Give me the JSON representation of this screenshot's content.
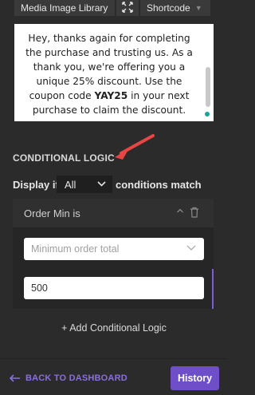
{
  "toolbar": {
    "media_label": "Media Image Library",
    "expand_icon": "expand-icon",
    "shortcode_label": "Shortcode"
  },
  "editor": {
    "text_before": "Hey, thanks again for completing the purchase and trusting us. As a thank you, we're offering you a unique 25% discount. Use the coupon code ",
    "coupon": "YAY25",
    "text_after": " in your next purchase to claim the discount."
  },
  "conditional_logic": {
    "title": "CONDITIONAL LOGIC",
    "display_prefix": "Display if",
    "match_value": "All",
    "display_suffix": "conditions match",
    "rule": {
      "title": "Order Min is",
      "select_placeholder": "Minimum order total",
      "input_value": "500"
    },
    "add_label": "+ Add Conditional Logic"
  },
  "footer": {
    "back_label": "BACK TO DASHBOARD",
    "history_label": "History"
  },
  "colors": {
    "accent": "#6f4fc9",
    "arrow": "#e84545",
    "background": "#2b2b2b"
  }
}
